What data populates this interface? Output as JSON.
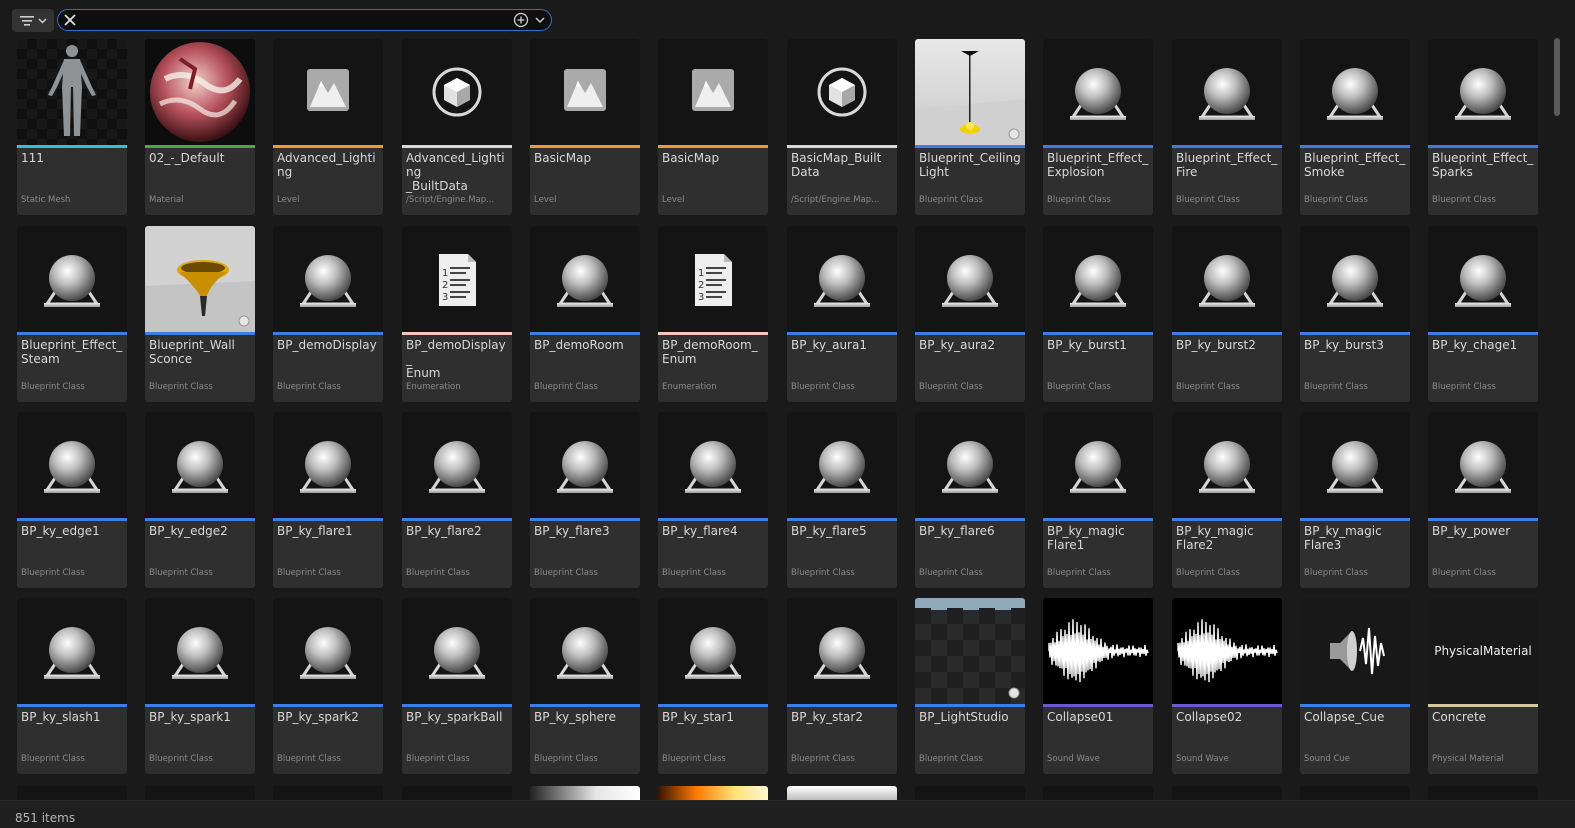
{
  "search": {
    "value": "",
    "placeholder": ""
  },
  "status": {
    "item_count": "851 items"
  },
  "colors": {
    "static_mesh": "#2ec6d6",
    "material": "#4fa64a",
    "level": "#f29a2e",
    "built_data": "#d8d8d8",
    "blueprint": "#3d7de6",
    "enumeration": "#f3c8b8",
    "sound_wave": "#6a5acd",
    "sound_cue": "#3d7de6",
    "physical_material": "#d9c99a"
  },
  "assets": [
    {
      "name": "111",
      "type": "Static Mesh",
      "thumb": "mannequin",
      "accent": "static_mesh"
    },
    {
      "name": "02_-_Default",
      "type": "Material",
      "thumb": "material_sphere",
      "accent": "material"
    },
    {
      "name": "Advanced_Lighting",
      "type": "Level",
      "thumb": "level",
      "accent": "level"
    },
    {
      "name": "Advanced_Lighting\n_BuiltData",
      "type": "/Script/Engine.Map...",
      "thumb": "cube",
      "accent": "built_data"
    },
    {
      "name": "BasicMap",
      "type": "Level",
      "thumb": "level",
      "accent": "level"
    },
    {
      "name": "BasicMap",
      "type": "Level",
      "thumb": "level",
      "accent": "level"
    },
    {
      "name": "BasicMap_Built\nData",
      "type": "/Script/Engine.Map...",
      "thumb": "cube",
      "accent": "built_data"
    },
    {
      "name": "Blueprint_Ceiling\nLight",
      "type": "Blueprint Class",
      "thumb": "ceiling_light",
      "accent": "blueprint"
    },
    {
      "name": "Blueprint_Effect_\nExplosion",
      "type": "Blueprint Class",
      "thumb": "blueprint",
      "accent": "blueprint"
    },
    {
      "name": "Blueprint_Effect_\nFire",
      "type": "Blueprint Class",
      "thumb": "blueprint",
      "accent": "blueprint"
    },
    {
      "name": "Blueprint_Effect_\nSmoke",
      "type": "Blueprint Class",
      "thumb": "blueprint",
      "accent": "blueprint"
    },
    {
      "name": "Blueprint_Effect_\nSparks",
      "type": "Blueprint Class",
      "thumb": "blueprint",
      "accent": "blueprint"
    },
    {
      "name": "Blueprint_Effect_\nSteam",
      "type": "Blueprint Class",
      "thumb": "blueprint",
      "accent": "blueprint"
    },
    {
      "name": "Blueprint_Wall\nSconce",
      "type": "Blueprint Class",
      "thumb": "wall_sconce",
      "accent": "blueprint"
    },
    {
      "name": "BP_demoDisplay",
      "type": "Blueprint Class",
      "thumb": "blueprint",
      "accent": "blueprint"
    },
    {
      "name": "BP_demoDisplay_\nEnum",
      "type": "Enumeration",
      "thumb": "enum",
      "accent": "enumeration"
    },
    {
      "name": "BP_demoRoom",
      "type": "Blueprint Class",
      "thumb": "blueprint",
      "accent": "blueprint"
    },
    {
      "name": "BP_demoRoom_\nEnum",
      "type": "Enumeration",
      "thumb": "enum",
      "accent": "enumeration"
    },
    {
      "name": "BP_ky_aura1",
      "type": "Blueprint Class",
      "thumb": "blueprint",
      "accent": "blueprint"
    },
    {
      "name": "BP_ky_aura2",
      "type": "Blueprint Class",
      "thumb": "blueprint",
      "accent": "blueprint"
    },
    {
      "name": "BP_ky_burst1",
      "type": "Blueprint Class",
      "thumb": "blueprint",
      "accent": "blueprint"
    },
    {
      "name": "BP_ky_burst2",
      "type": "Blueprint Class",
      "thumb": "blueprint",
      "accent": "blueprint"
    },
    {
      "name": "BP_ky_burst3",
      "type": "Blueprint Class",
      "thumb": "blueprint",
      "accent": "blueprint"
    },
    {
      "name": "BP_ky_chage1",
      "type": "Blueprint Class",
      "thumb": "blueprint",
      "accent": "blueprint"
    },
    {
      "name": "BP_ky_edge1",
      "type": "Blueprint Class",
      "thumb": "blueprint",
      "accent": "blueprint"
    },
    {
      "name": "BP_ky_edge2",
      "type": "Blueprint Class",
      "thumb": "blueprint",
      "accent": "blueprint"
    },
    {
      "name": "BP_ky_flare1",
      "type": "Blueprint Class",
      "thumb": "blueprint",
      "accent": "blueprint"
    },
    {
      "name": "BP_ky_flare2",
      "type": "Blueprint Class",
      "thumb": "blueprint",
      "accent": "blueprint"
    },
    {
      "name": "BP_ky_flare3",
      "type": "Blueprint Class",
      "thumb": "blueprint",
      "accent": "blueprint"
    },
    {
      "name": "BP_ky_flare4",
      "type": "Blueprint Class",
      "thumb": "blueprint",
      "accent": "blueprint"
    },
    {
      "name": "BP_ky_flare5",
      "type": "Blueprint Class",
      "thumb": "blueprint",
      "accent": "blueprint"
    },
    {
      "name": "BP_ky_flare6",
      "type": "Blueprint Class",
      "thumb": "blueprint",
      "accent": "blueprint"
    },
    {
      "name": "BP_ky_magic\nFlare1",
      "type": "Blueprint Class",
      "thumb": "blueprint",
      "accent": "blueprint"
    },
    {
      "name": "BP_ky_magic\nFlare2",
      "type": "Blueprint Class",
      "thumb": "blueprint",
      "accent": "blueprint"
    },
    {
      "name": "BP_ky_magic\nFlare3",
      "type": "Blueprint Class",
      "thumb": "blueprint",
      "accent": "blueprint"
    },
    {
      "name": "BP_ky_power",
      "type": "Blueprint Class",
      "thumb": "blueprint",
      "accent": "blueprint"
    },
    {
      "name": "BP_ky_slash1",
      "type": "Blueprint Class",
      "thumb": "blueprint",
      "accent": "blueprint"
    },
    {
      "name": "BP_ky_spark1",
      "type": "Blueprint Class",
      "thumb": "blueprint",
      "accent": "blueprint"
    },
    {
      "name": "BP_ky_spark2",
      "type": "Blueprint Class",
      "thumb": "blueprint",
      "accent": "blueprint"
    },
    {
      "name": "BP_ky_sparkBall",
      "type": "Blueprint Class",
      "thumb": "blueprint",
      "accent": "blueprint"
    },
    {
      "name": "BP_ky_sphere",
      "type": "Blueprint Class",
      "thumb": "blueprint",
      "accent": "blueprint"
    },
    {
      "name": "BP_ky_star1",
      "type": "Blueprint Class",
      "thumb": "blueprint",
      "accent": "blueprint"
    },
    {
      "name": "BP_ky_star2",
      "type": "Blueprint Class",
      "thumb": "blueprint",
      "accent": "blueprint"
    },
    {
      "name": "BP_LightStudio",
      "type": "Blueprint Class",
      "thumb": "light_studio",
      "accent": "blueprint"
    },
    {
      "name": "Collapse01",
      "type": "Sound Wave",
      "thumb": "waveform",
      "accent": "sound_wave"
    },
    {
      "name": "Collapse02",
      "type": "Sound Wave",
      "thumb": "waveform",
      "accent": "sound_wave"
    },
    {
      "name": "Collapse_Cue",
      "type": "Sound Cue",
      "thumb": "sound_cue",
      "accent": "sound_cue"
    },
    {
      "name": "Concrete",
      "type": "Physical Material",
      "thumb": "physical_material",
      "thumb_text": "PhysicalMaterial",
      "accent": "physical_material"
    }
  ],
  "partial_row": [
    "dark",
    "dark",
    "dark",
    "dark",
    "gradient_gray",
    "gradient_fire",
    "gradient_white",
    "dark",
    "dark",
    "dark",
    "dark",
    "dark"
  ]
}
